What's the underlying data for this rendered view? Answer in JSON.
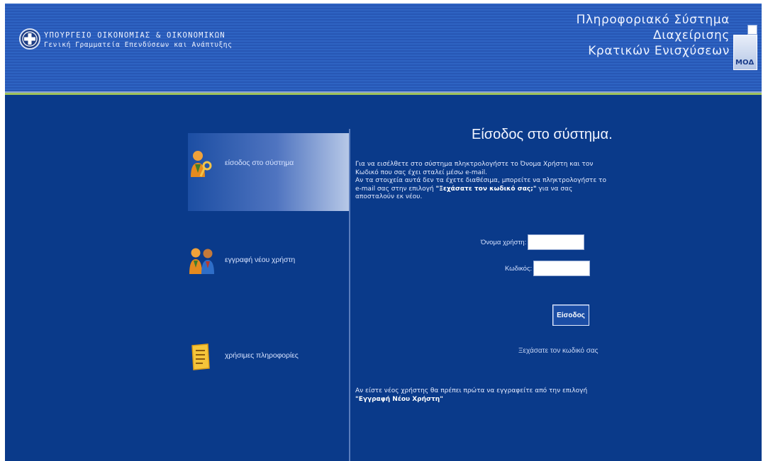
{
  "header": {
    "ministry_line1": "ΥΠΟΥΡΓΕΙΟ ΟΙΚΟΝΟΜΙΑΣ & ΟΙΚΟΝΟΜΙΚΩΝ",
    "ministry_line2": "Γενική Γραμματεία Επενδύσεων και Ανάπτυξης",
    "system_title_line1": "Πληροφοριακό Σύστημα",
    "system_title_line2": "Διαχείρισης",
    "system_title_line3": "Κρατικών Ενισχύσεων",
    "logo_text": "ΜΟΔ"
  },
  "nav": {
    "items": [
      {
        "label": "είσοδος στο σύστημα",
        "icon": "user-key-icon",
        "active": true
      },
      {
        "label": "εγγραφή νέου χρήστη",
        "icon": "users-icon",
        "active": false
      },
      {
        "label": "χρήσιμες πληροφορίες",
        "icon": "document-icon",
        "active": false
      }
    ]
  },
  "login": {
    "title": "Είσοδος στο σύστημα.",
    "instructions_part1": "Για να εισέλθετε στο σύστημα πληκτρολογήστε το Όνομα Χρήστη και τον Κωδικό που σας έχει σταλεί μέσω e-mail.",
    "instructions_part2": "Αν τα στοιχεία αυτά δεν τα έχετε διαθέσιμα, μπορείτε να πληκτρολογήστε το e-mail σας στην επιλογή ",
    "instructions_bold": "\"Ξεχάσατε τον κωδικό σας;\"",
    "instructions_part3": " για να σας αποσταλούν εκ νέου.",
    "username_label": "Όνομα χρήστη:",
    "username_value": "",
    "password_label": "Κωδικός:",
    "password_value": "",
    "submit_label": "Είσοδος",
    "forgot_label": "Ξεχάσατε τον κωδικό σας",
    "new_user_note": "Αν είστε νέος χρήστης θα πρέπει πρώτα να εγγραφείτε από την επιλογή",
    "new_user_bold": "\"Εγγραφή Νέου Χρήστη\""
  },
  "colors": {
    "background": "#0a3a8a",
    "header": "#2e63c2",
    "accent_line": "#9ec25a",
    "text": "#e6ecff"
  }
}
